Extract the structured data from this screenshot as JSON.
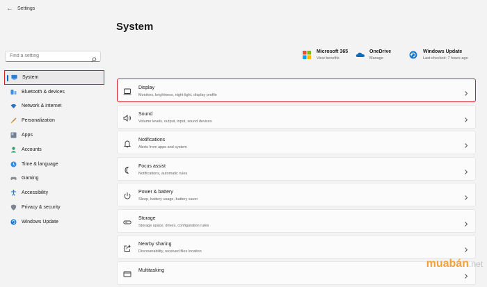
{
  "window": {
    "title": "Settings"
  },
  "search": {
    "placeholder": "Find a setting"
  },
  "sidebar": {
    "items": [
      {
        "label": "System",
        "icon": "system-icon"
      },
      {
        "label": "Bluetooth & devices",
        "icon": "bluetooth-icon"
      },
      {
        "label": "Network & internet",
        "icon": "wifi-icon"
      },
      {
        "label": "Personalization",
        "icon": "brush-icon"
      },
      {
        "label": "Apps",
        "icon": "apps-icon"
      },
      {
        "label": "Accounts",
        "icon": "person-icon"
      },
      {
        "label": "Time & language",
        "icon": "globe-clock-icon"
      },
      {
        "label": "Gaming",
        "icon": "gamepad-icon"
      },
      {
        "label": "Accessibility",
        "icon": "accessibility-icon"
      },
      {
        "label": "Privacy & security",
        "icon": "shield-icon"
      },
      {
        "label": "Windows Update",
        "icon": "windows-update-icon"
      }
    ]
  },
  "main": {
    "title": "System",
    "quick_links": [
      {
        "title": "Microsoft 365",
        "subtitle": "View benefits",
        "icon": "microsoft-logo-icon"
      },
      {
        "title": "OneDrive",
        "subtitle": "Manage",
        "icon": "onedrive-cloud-icon"
      },
      {
        "title": "Windows Update",
        "subtitle": "Last checked: 7 hours ago",
        "icon": "windows-update-icon"
      }
    ],
    "cards": [
      {
        "title": "Display",
        "subtitle": "Monitors, brightness, night light, display profile",
        "icon": "monitor-icon"
      },
      {
        "title": "Sound",
        "subtitle": "Volume levels, output, input, sound devices",
        "icon": "speaker-icon"
      },
      {
        "title": "Notifications",
        "subtitle": "Alerts from apps and system",
        "icon": "bell-icon"
      },
      {
        "title": "Focus assist",
        "subtitle": "Notifications, automatic rules",
        "icon": "moon-icon"
      },
      {
        "title": "Power & battery",
        "subtitle": "Sleep, battery usage, battery saver",
        "icon": "power-icon"
      },
      {
        "title": "Storage",
        "subtitle": "Storage space, drives, configuration rules",
        "icon": "storage-icon"
      },
      {
        "title": "Nearby sharing",
        "subtitle": "Discoverability, received files location",
        "icon": "share-icon"
      },
      {
        "title": "Multitasking",
        "subtitle": "",
        "icon": "multitasking-icon"
      }
    ]
  },
  "watermark": {
    "brand": "muabán",
    "tld": "net"
  },
  "colors": {
    "accent": "#0067c0",
    "highlight": "#d4202a",
    "watermark": "#f2a23a"
  }
}
